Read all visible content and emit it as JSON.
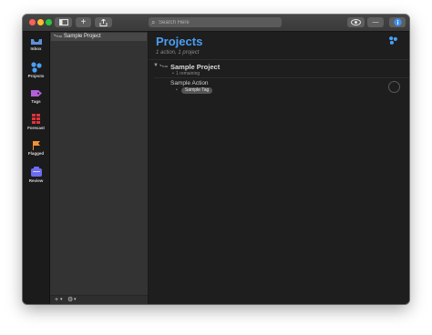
{
  "toolbar": {
    "search_placeholder": "Search Here",
    "new_action_label": "+",
    "overflow_label": "—"
  },
  "sidebar": {
    "items": [
      {
        "label": "Inbox",
        "icon": "inbox-icon"
      },
      {
        "label": "Projects",
        "icon": "projects-icon"
      },
      {
        "label": "Tags",
        "icon": "tag-icon"
      },
      {
        "label": "Forecast",
        "icon": "forecast-icon"
      },
      {
        "label": "Flagged",
        "icon": "flag-icon"
      },
      {
        "label": "Review",
        "icon": "review-icon"
      }
    ]
  },
  "list": {
    "items": [
      {
        "label": "Sample Project"
      }
    ],
    "footer_add": "+",
    "footer_settings": "⚙"
  },
  "main": {
    "title": "Projects",
    "subtitle": "1 action, 1 project",
    "project": {
      "title": "Sample Project",
      "remaining": "1 remaining"
    },
    "action": {
      "title": "Sample Action",
      "tag": "Sample Tag"
    }
  },
  "colors": {
    "accent": "#4a9ff5",
    "tag": "#b061d8",
    "forecast": "#e0333b",
    "flag": "#f29233",
    "review": "#6c6cf0"
  }
}
